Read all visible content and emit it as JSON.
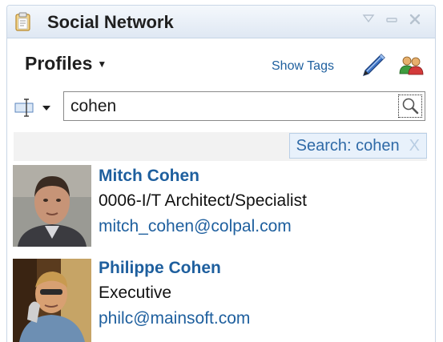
{
  "window": {
    "title": "Social Network",
    "icons": [
      "clipboard-icon",
      "menu-triangle-icon",
      "minimize-icon",
      "close-icon"
    ]
  },
  "toolbar": {
    "profiles_label": "Profiles",
    "show_tags_label": "Show Tags",
    "icons": [
      "pen-icon",
      "people-icon"
    ]
  },
  "search": {
    "value": "cohen",
    "type_icon": "search-type-icon",
    "button_icon": "magnifier-icon"
  },
  "filter": {
    "label": "Search: cohen",
    "remove": "X"
  },
  "results": [
    {
      "name": "Mitch Cohen",
      "role": "0006-I/T Architect/Specialist",
      "email": "mitch_cohen@colpal.com"
    },
    {
      "name": "Philippe Cohen",
      "role": "Executive",
      "email": "philc@mainsoft.com"
    }
  ],
  "colors": {
    "link": "#1e5f9e",
    "titlebar": "#dfe8f3",
    "chip_bg": "#e8f1fb"
  }
}
